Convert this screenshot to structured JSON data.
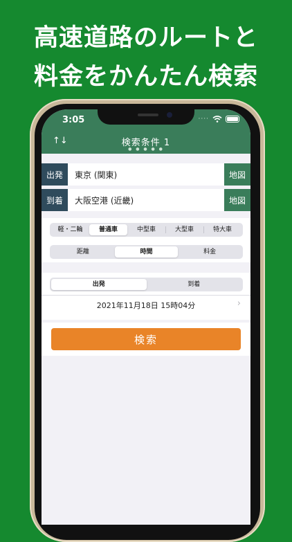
{
  "promo": {
    "line1": "高速道路のルートと",
    "line2": "料金をかんたん検索"
  },
  "status": {
    "time": "3:05",
    "signal": "····"
  },
  "nav": {
    "title": "検索条件 1",
    "swap_icon": "↑↓",
    "page_dots": "● ● ● ● ●"
  },
  "route": {
    "from_label": "出発",
    "from_value": "東京 (関東)",
    "to_label": "到着",
    "to_value": "大阪空港 (近畿)",
    "map_label": "地図"
  },
  "vehicle": {
    "options": [
      "軽・二輪",
      "普通車",
      "中型車",
      "大型車",
      "特大車"
    ],
    "selected": "普通車"
  },
  "sort": {
    "options": [
      "距離",
      "時間",
      "料金"
    ],
    "selected": "時間"
  },
  "timing": {
    "options": [
      "出発",
      "到着"
    ],
    "selected": "出発",
    "datetime": "2021年11月18日 15時04分"
  },
  "search_label": "検索",
  "colors": {
    "background": "#15892f",
    "nav": "#3a7d5a",
    "label": "#2f4b5c",
    "button": "#e98428"
  },
  "icons": [
    "swap-icon",
    "wifi-icon",
    "battery-icon",
    "chevron-right-icon"
  ]
}
